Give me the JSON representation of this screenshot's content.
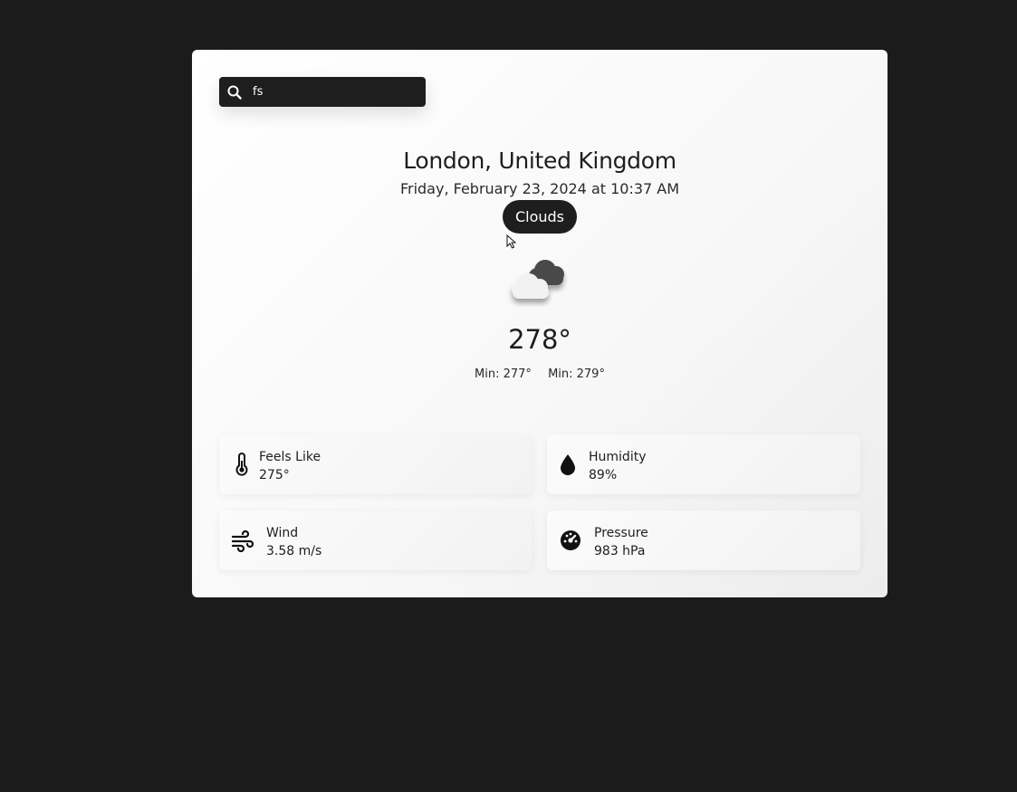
{
  "search": {
    "value": "fs",
    "icon": "search-icon"
  },
  "weather": {
    "location": "London, United Kingdom",
    "datetime": "Friday, February 23, 2024 at 10:37 AM",
    "condition": "Clouds",
    "condition_icon": "clouds-icon",
    "temperature": "278°",
    "min_label": "Min: 277°",
    "max_label": "Min: 279°"
  },
  "details": [
    {
      "label": "Feels Like",
      "value": "275°",
      "icon": "thermometer-icon"
    },
    {
      "label": "Humidity",
      "value": "89%",
      "icon": "water-drop-icon"
    },
    {
      "label": "Wind",
      "value": "3.58 m/s",
      "icon": "wind-icon"
    },
    {
      "label": "Pressure",
      "value": "983 hPa",
      "icon": "gauge-icon"
    }
  ],
  "colors": {
    "background": "#1b1b1b",
    "card": "#ffffff",
    "accent_dark": "#1e1e1e"
  }
}
